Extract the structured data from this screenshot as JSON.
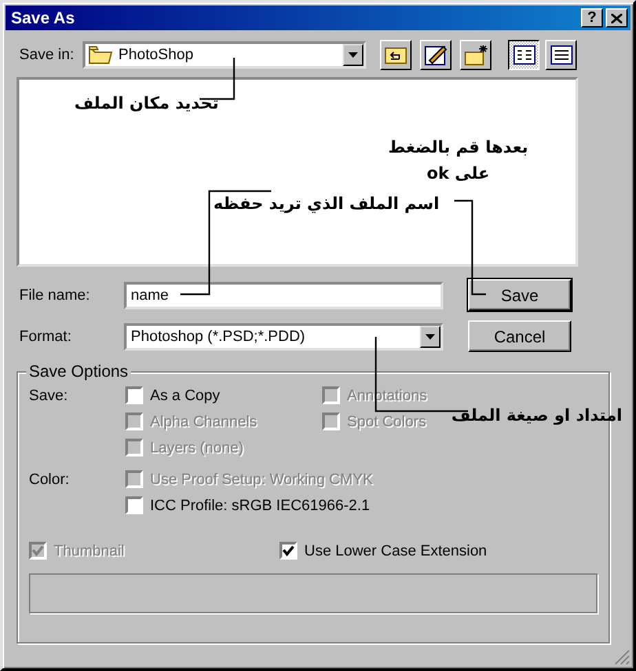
{
  "window": {
    "title": "Save As",
    "help": "?"
  },
  "save_in": {
    "label": "Save in:",
    "value": "PhotoShop"
  },
  "views": [
    {
      "kind": "list",
      "selected": true
    },
    {
      "kind": "details",
      "selected": false
    }
  ],
  "file_name": {
    "label": "File name:",
    "value": "name"
  },
  "format": {
    "label": "Format:",
    "value": "Photoshop (*.PSD;*.PDD)"
  },
  "buttons": [
    {
      "label": "Save",
      "default": true
    },
    {
      "label": "Cancel",
      "default": false
    }
  ],
  "save_options": {
    "title": "Save Options",
    "groups": [
      {
        "label": "Save:",
        "options": [
          {
            "label": "As a Copy",
            "checked": false,
            "disabled": false
          },
          {
            "label": "Annotations",
            "checked": false,
            "disabled": true
          },
          {
            "label": "Alpha Channels",
            "checked": false,
            "disabled": true
          },
          {
            "label": "Spot Colors",
            "checked": false,
            "disabled": true
          },
          {
            "label": "Layers (none)",
            "checked": false,
            "disabled": true
          }
        ]
      },
      {
        "label": "Color:",
        "options": [
          {
            "label": "Use Proof Setup:  Working CMYK",
            "checked": false,
            "disabled": true
          },
          {
            "label": "ICC Profile:  sRGB IEC61966-2.1",
            "checked": false,
            "disabled": false
          }
        ]
      }
    ],
    "extra": [
      {
        "label": "Thumbnail",
        "checked": true,
        "disabled": true
      },
      {
        "label": "Use Lower Case Extension",
        "checked": true,
        "disabled": false
      }
    ]
  },
  "annotations": [
    {
      "text": "تحديد مكان الملف"
    },
    {
      "text": "بعدها قم بالضغط\nعلى ok"
    },
    {
      "text": "اسم الملف الذي تريد حفظه"
    },
    {
      "text": "امتداد او صيغة الملف"
    }
  ]
}
